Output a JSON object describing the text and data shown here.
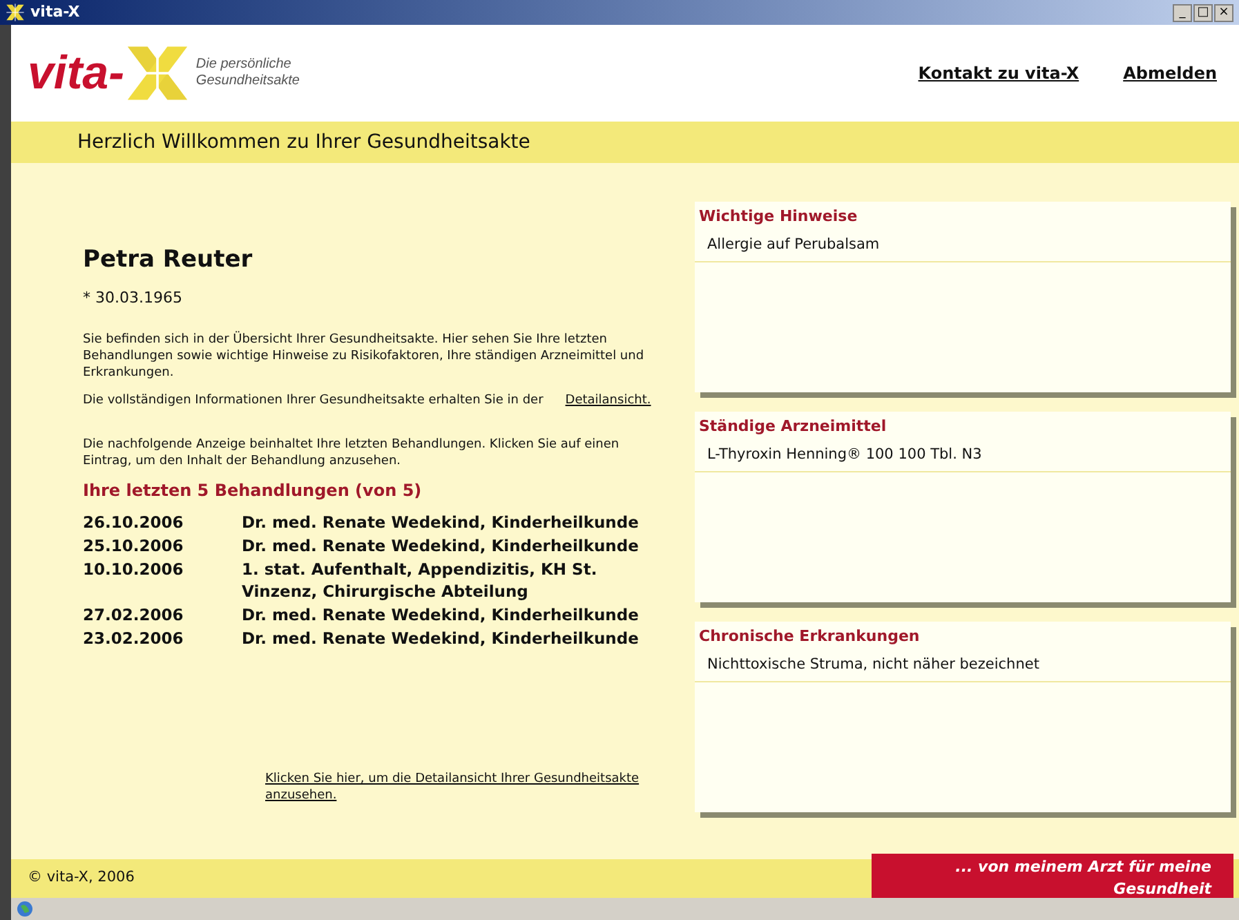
{
  "window": {
    "title": "vita-X",
    "controls": [
      "_",
      "□",
      "×"
    ]
  },
  "header": {
    "logo_word": "vita-",
    "logo_tagline": [
      "Die persönliche",
      "Gesundheitsakte"
    ],
    "links": [
      "Kontakt zu vita-X",
      "Abmelden"
    ]
  },
  "welcome": "Herzlich Willkommen zu Ihrer Gesundheitsakte",
  "patient": {
    "name": "Petra Reuter",
    "birth": "* 30.03.1965"
  },
  "intro": "Sie befinden sich in der Übersicht Ihrer Gesundheitsakte. Hier sehen Sie Ihre letzten Behandlungen sowie wichtige Hinweise zu Risikofaktoren, Ihre  ständigen Arzneimittel und Erkrankungen.",
  "detail_text": "Die vollständigen Informationen Ihrer Gesundheitsakte erhalten Sie in der",
  "detail_link": "Detailansicht.",
  "list_intro": "Die nachfolgende Anzeige beinhaltet Ihre letzten Behandlungen. Klicken Sie auf einen Eintrag, um den Inhalt der Behandlung anzusehen.",
  "treatments_title": "Ihre letzten 5 Behandlungen (von 5)",
  "treatments": [
    {
      "date": "26.10.2006",
      "text": "Dr. med. Renate Wedekind, Kinderheilkunde"
    },
    {
      "date": "25.10.2006",
      "text": "Dr. med. Renate Wedekind, Kinderheilkunde"
    },
    {
      "date": "10.10.2006",
      "text": "1. stat. Aufenthalt, Appendizitis, KH St. Vinzenz, Chirurgische Abteilung"
    },
    {
      "date": "27.02.2006",
      "text": "Dr. med. Renate Wedekind, Kinderheilkunde"
    },
    {
      "date": "23.02.2006",
      "text": "Dr. med. Renate Wedekind, Kinderheilkunde"
    }
  ],
  "bottom_link": "Klicken Sie hier, um die Detailansicht Ihrer  Gesundheitsakte anzusehen.",
  "panels": [
    {
      "title": "Wichtige Hinweise",
      "items": [
        "Allergie auf Perubalsam"
      ]
    },
    {
      "title": "Ständige Arzneimittel",
      "items": [
        "L-Thyroxin Henning® 100 100 Tbl.  N3"
      ]
    },
    {
      "title": "Chronische Erkrankungen",
      "items": [
        "Nichttoxische Struma, nicht näher bezeichnet"
      ]
    }
  ],
  "footer": {
    "copyright": "© vita-X, 2006",
    "slogan": "... von meinem Arzt für meine Gesundheit"
  }
}
